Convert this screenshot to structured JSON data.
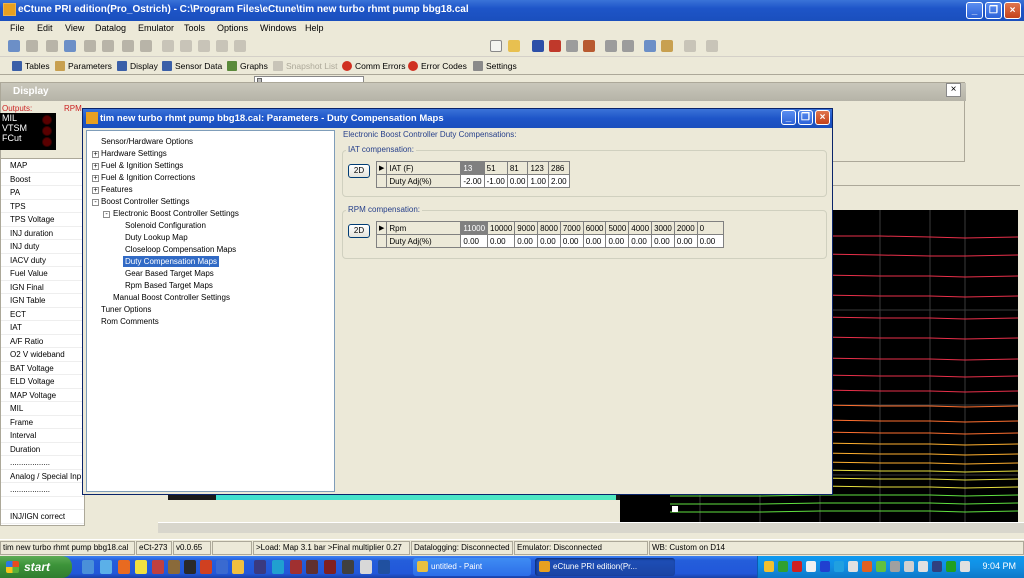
{
  "main_window": {
    "title": "eCtune PRI edition(Pro_Ostrich) - C:\\Program Files\\eCtune\\tim new turbo rhmt pump bbg18.cal",
    "minimize": "_",
    "maximize": "❐",
    "close": "×"
  },
  "menu": [
    "File",
    "Edit",
    "View",
    "Datalog",
    "Emulator",
    "Tools",
    "Options",
    "Windows",
    "Help"
  ],
  "toolbar2": [
    "Tables",
    "Parameters",
    "Display",
    "Sensor Data",
    "Graphs",
    "Snapshot List",
    "Comm Errors",
    "Error Codes",
    "Settings"
  ],
  "display_window": {
    "title": "Display",
    "outputs_label": "Outputs:",
    "rpm_label": "RPM",
    "close": "×",
    "outputs": [
      "MIL",
      "VTSM",
      "FCut"
    ]
  },
  "sensor_list": [
    "MAP",
    "Boost",
    "PA",
    "TPS",
    "TPS Voltage",
    "INJ duration",
    "INJ duty",
    "IACV duty",
    "Fuel Value",
    "IGN Final",
    "IGN Table",
    "ECT",
    "IAT",
    "A/F Ratio",
    "O2 V wideband",
    "BAT Voltage",
    "ELD Voltage",
    "MAP Voltage",
    "MIL",
    "Frame",
    "Interval",
    "Duration",
    "..................",
    "Analog / Special Inp",
    "..................",
    "",
    "INJ/IGN correct"
  ],
  "dialog": {
    "title": "tim new turbo rhmt pump bbg18.cal: Parameters - Duty Compensation Maps",
    "tree": [
      {
        "label": "Sensor/Hardware Options"
      },
      {
        "label": "Hardware Settings",
        "exp": "+"
      },
      {
        "label": "Fuel & Ignition Settings",
        "exp": "+"
      },
      {
        "label": "Fuel & Ignition Corrections",
        "exp": "+"
      },
      {
        "label": "Features",
        "exp": "+"
      },
      {
        "label": "Boost Controller Settings",
        "exp": "-"
      },
      {
        "label": "Electronic Boost Controller Settings",
        "exp": "-"
      },
      {
        "label": "Solenoid Configuration"
      },
      {
        "label": "Duty Lookup Map"
      },
      {
        "label": "Closeloop Compensation Maps"
      },
      {
        "label": "Duty Compensation Maps",
        "selected": true
      },
      {
        "label": "Gear Based Target Maps"
      },
      {
        "label": "Rpm Based Target Maps"
      },
      {
        "label": "Manual Boost Controller Settings"
      },
      {
        "label": "Tuner Options"
      },
      {
        "label": "Rom Comments"
      }
    ],
    "panel_title": "Electronic Boost Controller Duty Compensations:",
    "iat": {
      "group_label": "IAT compensation:",
      "button": "2D",
      "header_label": "IAT (F)",
      "row_label": "Duty Adj(%)",
      "headers": [
        "13",
        "51",
        "81",
        "123",
        "286"
      ],
      "values": [
        "-2.00",
        "-1.00",
        "0.00",
        "1.00",
        "2.00"
      ]
    },
    "rpm": {
      "group_label": "RPM compensation:",
      "button": "2D",
      "header_label": "Rpm",
      "row_label": "Duty Adj(%)",
      "headers": [
        "11000",
        "10000",
        "9000",
        "8000",
        "7000",
        "6000",
        "5000",
        "4000",
        "3000",
        "2000",
        "0"
      ],
      "values": [
        "0.00",
        "0.00",
        "0.00",
        "0.00",
        "0.00",
        "0.00",
        "0.00",
        "0.00",
        "0.00",
        "0.00",
        "0.00"
      ]
    }
  },
  "statusbar": [
    "tim new turbo rhmt pump bbg18.cal",
    "eCt-273",
    "v0.0.65",
    "",
    ">Load: Map 3.1 bar >Final multiplier 0.27",
    "Datalogging: Disconnected",
    "Emulator: Disconnected",
    "WB: Custom on D14"
  ],
  "taskbar": {
    "start": "start",
    "tasks": [
      "untitled - Paint",
      "eCtune PRI edition(Pr..."
    ],
    "clock": "9:04 PM"
  },
  "colors": {
    "xp_blue": "#245edb",
    "selection": "#316ac5",
    "group_label": "#27408b"
  }
}
